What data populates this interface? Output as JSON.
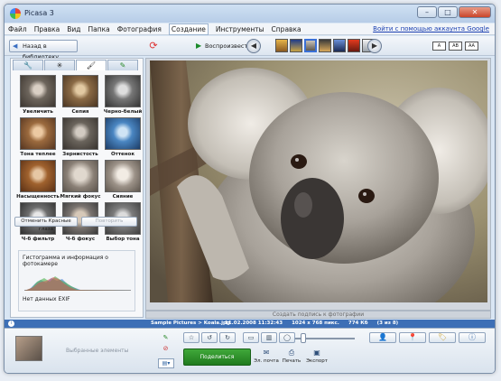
{
  "window": {
    "title": "Picasa 3"
  },
  "menu": {
    "items": [
      "Файл",
      "Правка",
      "Вид",
      "Папка",
      "Фотография",
      "Создание",
      "Инструменты",
      "Справка"
    ],
    "active_index": 5,
    "google_link": "Войти с помощью аккаунта Google"
  },
  "toolbar": {
    "back_label": "Назад в библиотеку",
    "play_label": "Воспроизвести",
    "caption_toggles": [
      "A",
      "AB",
      "AA"
    ]
  },
  "effects_panel": {
    "effects": [
      "Увеличить",
      "Сепия",
      "Черно-белый",
      "Тона теплее",
      "Зернистость",
      "Оттенок",
      "Насыщенность",
      "Мягкий фокус",
      "Сияние",
      "Ч-б фильтр",
      "Ч-б фокус",
      "Выбор тона"
    ],
    "undo_redeye_label": "Отменить Красные глаза",
    "redo_label": "Повторить",
    "histogram_title": "Гистограмма и информация о фотокамере",
    "no_exif": "Нет данных EXIF"
  },
  "photo": {
    "caption_placeholder": "Создать подпись к фотографии"
  },
  "status": {
    "path": "Sample Pictures > Koala.jpg",
    "date": "11.02.2008 11:32:43",
    "dimensions": "1024 x 768 пикс.",
    "size": "774 Кб",
    "position": "(3 из 8)"
  },
  "tray": {
    "label": "Выбранные элементы",
    "share_label": "Поделиться",
    "actions": [
      "Эл. почта",
      "Печать",
      "Экспорт"
    ]
  }
}
